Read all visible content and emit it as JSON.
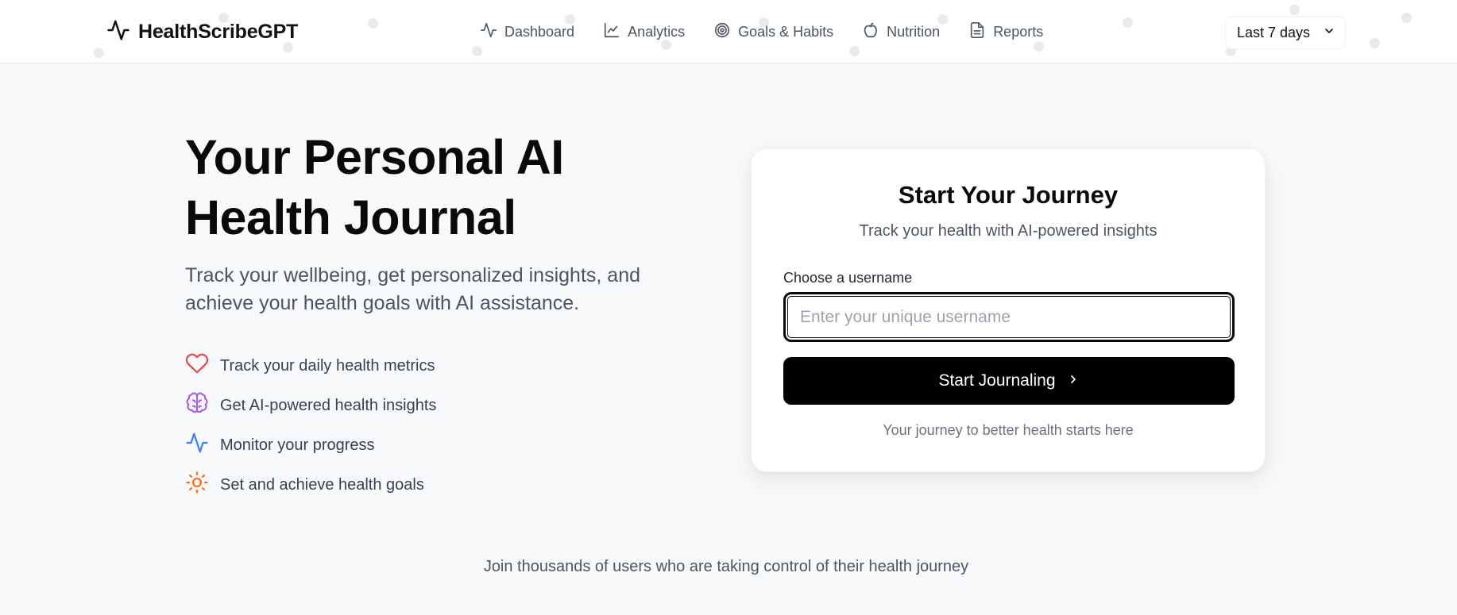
{
  "header": {
    "brand": "HealthScribeGPT",
    "nav": [
      {
        "label": "Dashboard",
        "icon": "activity-icon"
      },
      {
        "label": "Analytics",
        "icon": "line-chart-icon"
      },
      {
        "label": "Goals & Habits",
        "icon": "target-icon"
      },
      {
        "label": "Nutrition",
        "icon": "apple-icon"
      },
      {
        "label": "Reports",
        "icon": "file-text-icon"
      }
    ],
    "range_select": {
      "value": "Last 7 days",
      "icon": "chevron-down-icon"
    }
  },
  "hero": {
    "title_line1": "Your Personal AI",
    "title_line2": "Health Journal",
    "subtitle": "Track your wellbeing, get personalized insights, and achieve your health goals with AI assistance.",
    "features": [
      {
        "label": "Track your daily health metrics",
        "icon": "heart-icon",
        "color": "#ef4444"
      },
      {
        "label": "Get AI-powered health insights",
        "icon": "brain-icon",
        "color": "#a855f7"
      },
      {
        "label": "Monitor your progress",
        "icon": "activity-icon",
        "color": "#3b82f6"
      },
      {
        "label": "Set and achieve health goals",
        "icon": "sun-icon",
        "color": "#f97316"
      }
    ]
  },
  "card": {
    "title": "Start Your Journey",
    "subtitle": "Track your health with AI-powered insights",
    "field_label": "Choose a username",
    "input_value": "",
    "input_placeholder": "Enter your unique username",
    "button_label": "Start Journaling",
    "button_icon": "chevron-right-icon",
    "footer": "Your journey to better health starts here"
  },
  "footer": {
    "join_text": "Join thousands of users who are taking control of their health journey"
  }
}
